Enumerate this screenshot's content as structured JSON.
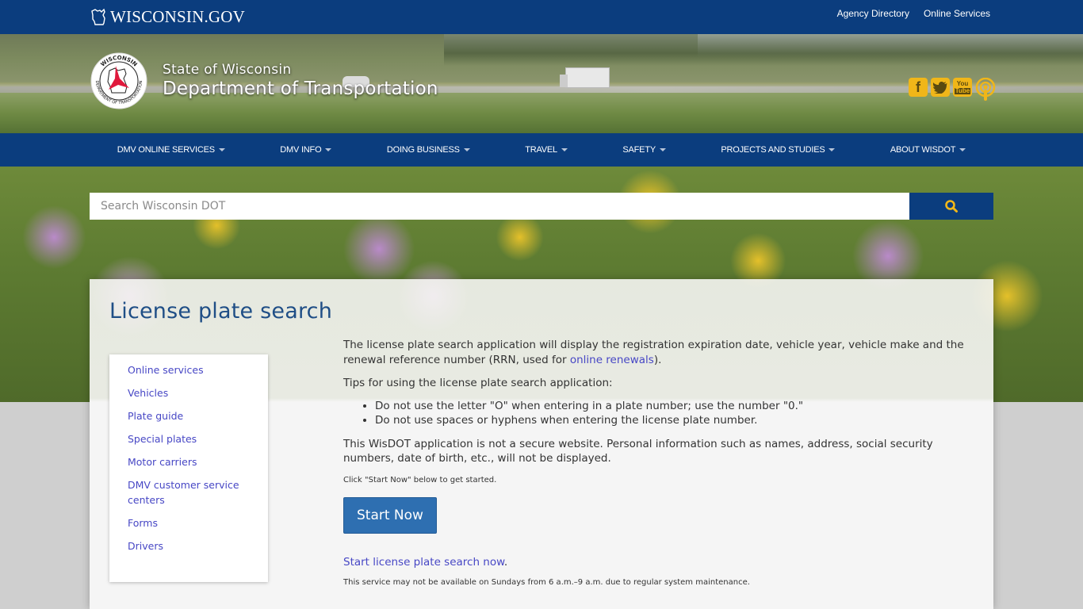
{
  "topbar": {
    "logo_text": "WISCONSIN.GOV",
    "links": [
      "Agency Directory",
      "Online Services"
    ]
  },
  "header": {
    "state": "State of Wisconsin",
    "department": "Department of Transportation",
    "logo_ring_top": "WISCONSIN",
    "logo_ring_bottom": "DEPARTMENT OF TRANSPORTATION",
    "social": [
      {
        "name": "facebook-icon",
        "glyph": "f"
      },
      {
        "name": "twitter-icon",
        "glyph": "🐦"
      },
      {
        "name": "youtube-icon",
        "glyph": "You Tube"
      },
      {
        "name": "podcast-icon",
        "glyph": ""
      }
    ]
  },
  "nav": {
    "items": [
      {
        "label": "DMV ONLINE SERVICES"
      },
      {
        "label": "DMV INFO"
      },
      {
        "label": "DOING BUSINESS"
      },
      {
        "label": "TRAVEL"
      },
      {
        "label": "SAFETY"
      },
      {
        "label": "PROJECTS AND STUDIES"
      },
      {
        "label": "ABOUT WISDOT"
      }
    ]
  },
  "search": {
    "placeholder": "Search Wisconsin DOT",
    "value": "",
    "icon": "search-icon",
    "accent": "#f0b619"
  },
  "page": {
    "title": "License plate search"
  },
  "sidenav": {
    "items": [
      "Online services",
      "Vehicles",
      "Plate guide",
      "Special plates",
      "Motor carriers",
      "DMV customer service centers",
      "Forms",
      "Drivers"
    ]
  },
  "content": {
    "intro_before": "The license plate search application will display the registration expiration date, vehicle year, vehicle make and the renewal reference number (RRN, used for ",
    "intro_link": "online renewals",
    "intro_after": ").",
    "tips_heading": "Tips for using the license plate search application:",
    "tips": [
      "Do not use the letter \"O\" when entering in a plate number; use the number \"0.\"",
      "Do not use spaces or hyphens when entering the license plate number."
    ],
    "security_note": "This WisDOT application is not a secure website. Personal information such as names, address, social security numbers, date of birth, etc., will not be displayed.",
    "click_note": "Click \"Start Now\" below to get started.",
    "start_button": "Start Now",
    "start_link": "Start license plate search now",
    "start_link_after": ".",
    "maintenance_note": "This service may not be available on Sundays from 6 a.m.–9 a.m. due to regular system maintenance."
  },
  "colors": {
    "brand_blue": "#0b3d7e",
    "title_blue": "#1f4e86",
    "link": "#4747c5",
    "button": "#2e6fb1",
    "social_gold": "#f0b619"
  }
}
